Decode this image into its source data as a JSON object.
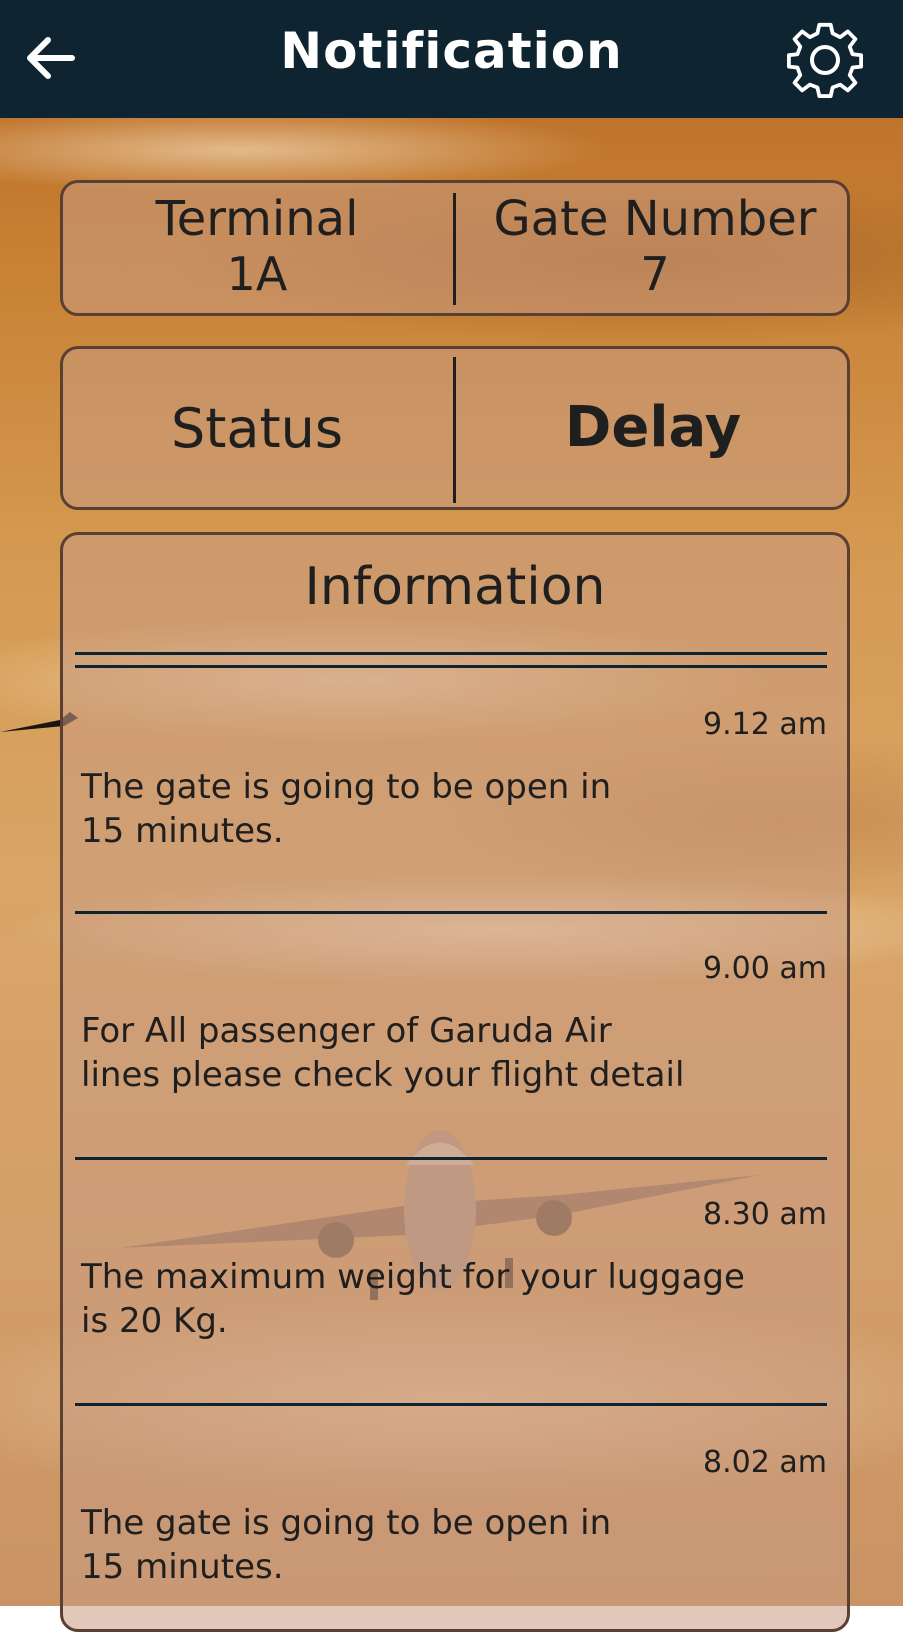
{
  "header": {
    "title": "Notification"
  },
  "summary": {
    "terminal_label": "Terminal",
    "terminal_value": "1A",
    "gate_label": "Gate Number",
    "gate_value": "7"
  },
  "status": {
    "label": "Status",
    "value": "Delay"
  },
  "information": {
    "title": "Information",
    "messages": [
      {
        "time": "9.12 am",
        "text_line1": "The gate is going to be open in",
        "text_line2": "15 minutes."
      },
      {
        "time": "9.00 am",
        "text_line1": "For All passenger of Garuda Air",
        "text_line2": "lines please check your flight detail"
      },
      {
        "time": "8.30 am",
        "text_line1": "The maximum weight for your luggage",
        "text_line2": "is 20 Kg."
      },
      {
        "time": "8.02 am",
        "text_line1": "The gate is going to be open in",
        "text_line2": "15 minutes."
      }
    ]
  },
  "icons": {
    "back": "arrow-left-icon",
    "settings": "gear-icon"
  },
  "colors": {
    "header_bg": "#0e2430",
    "card_border": "#5a4032",
    "sky": "#d59a52"
  }
}
